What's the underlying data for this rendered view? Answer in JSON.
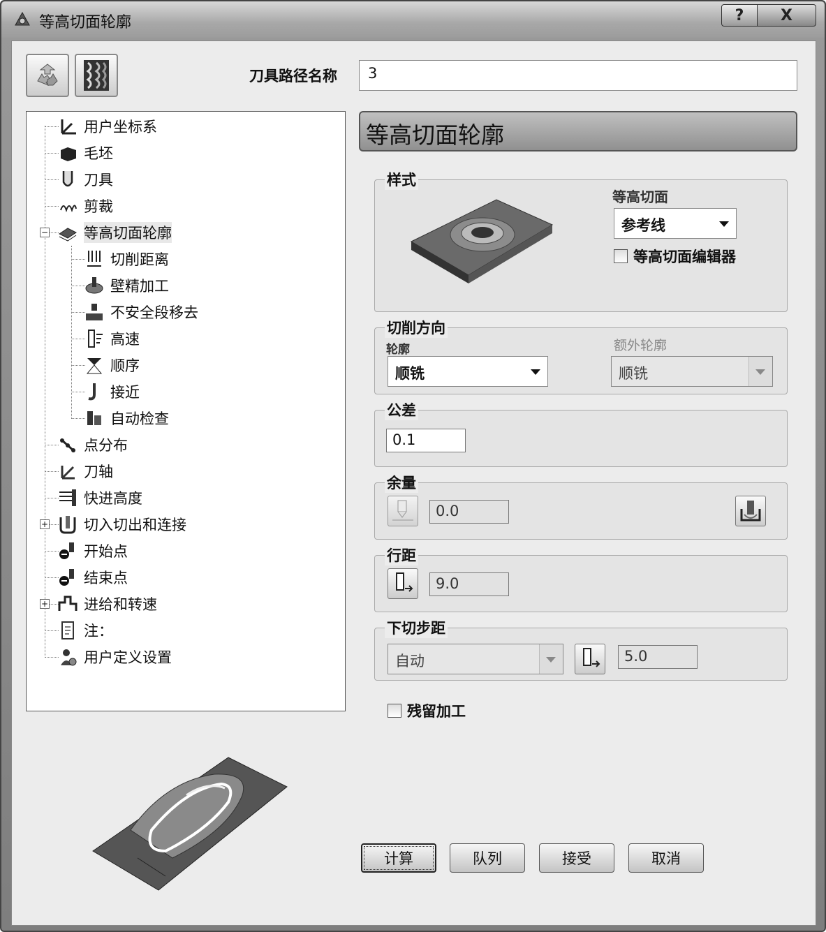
{
  "window": {
    "title": "等高切面轮廓",
    "help_glyph": "?",
    "close_glyph": "X"
  },
  "toolpath": {
    "name_label": "刀具路径名称",
    "name_value": "3"
  },
  "tree": {
    "items": [
      {
        "label": "用户坐标系"
      },
      {
        "label": "毛坯"
      },
      {
        "label": "刀具"
      },
      {
        "label": "剪裁"
      },
      {
        "label": "等高切面轮廓"
      },
      {
        "label": "切削距离"
      },
      {
        "label": "壁精加工"
      },
      {
        "label": "不安全段移去"
      },
      {
        "label": "高速"
      },
      {
        "label": "顺序"
      },
      {
        "label": "接近"
      },
      {
        "label": "自动检查"
      },
      {
        "label": "点分布"
      },
      {
        "label": "刀轴"
      },
      {
        "label": "快进高度"
      },
      {
        "label": "切入切出和连接"
      },
      {
        "label": "开始点"
      },
      {
        "label": "结束点"
      },
      {
        "label": "进给和转速"
      },
      {
        "label": "注："
      },
      {
        "label": "用户定义设置"
      }
    ],
    "expand_minus": "−",
    "expand_plus": "+"
  },
  "panel": {
    "header": "等高切面轮廓",
    "style": {
      "title": "样式",
      "contour_label": "等高切面",
      "contour_value": "参考线",
      "editor_checkbox": "等高切面编辑器"
    },
    "cut_direction": {
      "title": "切削方向",
      "profile_label": "轮廓",
      "profile_value": "顺铣",
      "extra_label": "额外轮廓",
      "extra_value": "顺铣"
    },
    "tolerance": {
      "title": "公差",
      "value": "0.1"
    },
    "allowance": {
      "title": "余量",
      "value": "0.0"
    },
    "stepover": {
      "title": "行距",
      "value": "9.0"
    },
    "stepdown": {
      "title": "下切步距",
      "mode": "自动",
      "value": "5.0"
    },
    "rest_checkbox": "残留加工"
  },
  "buttons": {
    "calculate": "计算",
    "queue": "队列",
    "accept": "接受",
    "cancel": "取消"
  }
}
